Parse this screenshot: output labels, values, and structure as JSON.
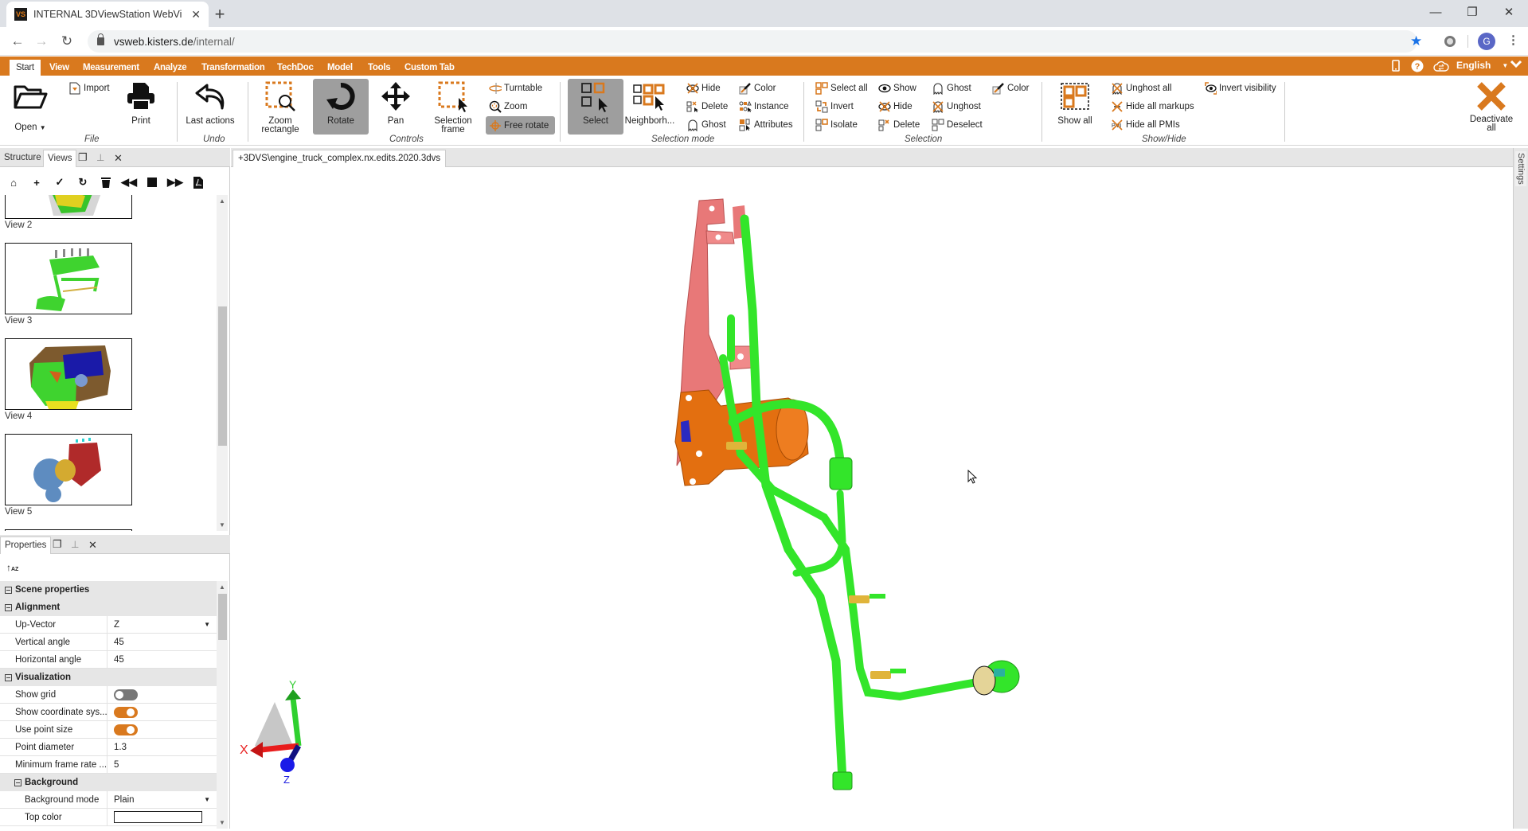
{
  "browser": {
    "tab_title": "INTERNAL 3DViewStation WebVi",
    "favicon_text": "VS",
    "url_host": "vsweb.kisters.de",
    "url_path": "/internal/",
    "profile_initial": "G"
  },
  "ribbon_tabs": [
    "Start",
    "View",
    "Measurement",
    "Analyze",
    "Transformation",
    "TechDoc",
    "Model",
    "Tools",
    "Custom Tab"
  ],
  "active_ribbon_tab": "Start",
  "top_right": {
    "language": "English"
  },
  "ribbon": {
    "file": {
      "label": "File",
      "open": "Open",
      "import": "Import",
      "print": "Print"
    },
    "undo": {
      "label": "Undo",
      "last_actions": "Last actions"
    },
    "controls": {
      "label": "Controls",
      "zoom_rectangle": "Zoom rectangle",
      "rotate": "Rotate",
      "pan": "Pan",
      "selection_frame": "Selection frame",
      "turntable": "Turntable",
      "zoom": "Zoom",
      "free_rotate": "Free rotate"
    },
    "selection_mode": {
      "label": "Selection mode",
      "select": "Select",
      "neighborhood": "Neighborh...",
      "hide": "Hide",
      "delete": "Delete",
      "ghost": "Ghost",
      "color": "Color",
      "instance": "Instance",
      "attributes": "Attributes"
    },
    "selection": {
      "label": "Selection",
      "select_all": "Select all",
      "invert": "Invert",
      "isolate": "Isolate",
      "show": "Show",
      "hide": "Hide",
      "delete": "Delete",
      "ghost": "Ghost",
      "unghost": "Unghost",
      "deselect": "Deselect",
      "color": "Color"
    },
    "show_hide": {
      "label": "Show/Hide",
      "show_all": "Show all",
      "unghost_all": "Unghost all",
      "hide_all_markups": "Hide all markups",
      "hide_all_pmis": "Hide all PMIs",
      "invert_visibility": "Invert visibility"
    },
    "deactivate_all": "Deactivate all"
  },
  "left_panel": {
    "tabs": [
      "Structure",
      "Views"
    ],
    "active_tab": "Views",
    "views": [
      "View 2",
      "View 3",
      "View 4",
      "View 5"
    ]
  },
  "properties": {
    "tab": "Properties",
    "scene_properties": "Scene properties",
    "alignment": "Alignment",
    "up_vector_label": "Up-Vector",
    "up_vector": "Z",
    "vertical_angle_label": "Vertical angle",
    "vertical_angle": "45",
    "horizontal_angle_label": "Horizontal angle",
    "horizontal_angle": "45",
    "visualization": "Visualization",
    "show_grid_label": "Show grid",
    "show_grid": false,
    "show_coord_label": "Show coordinate sys...",
    "show_coord": true,
    "use_point_size_label": "Use point size",
    "use_point_size": true,
    "point_diameter_label": "Point diameter",
    "point_diameter": "1.3",
    "min_frame_rate_label": "Minimum frame rate ...",
    "min_frame_rate": "5",
    "background": "Background",
    "background_mode_label": "Background mode",
    "background_mode": "Plain",
    "top_color_label": "Top color"
  },
  "document": {
    "tab": "+3DVS\\engine_truck_complex.nx.edits.2020.3dvs"
  },
  "settings_label": "Settings",
  "axes": {
    "x": "X",
    "y": "Y",
    "z": "Z"
  },
  "colors": {
    "accent": "#d9791e",
    "active_button": "#9e9e9e",
    "pipe": "#33e52a",
    "bracket": "#e87878",
    "housing": "#e36f10"
  }
}
